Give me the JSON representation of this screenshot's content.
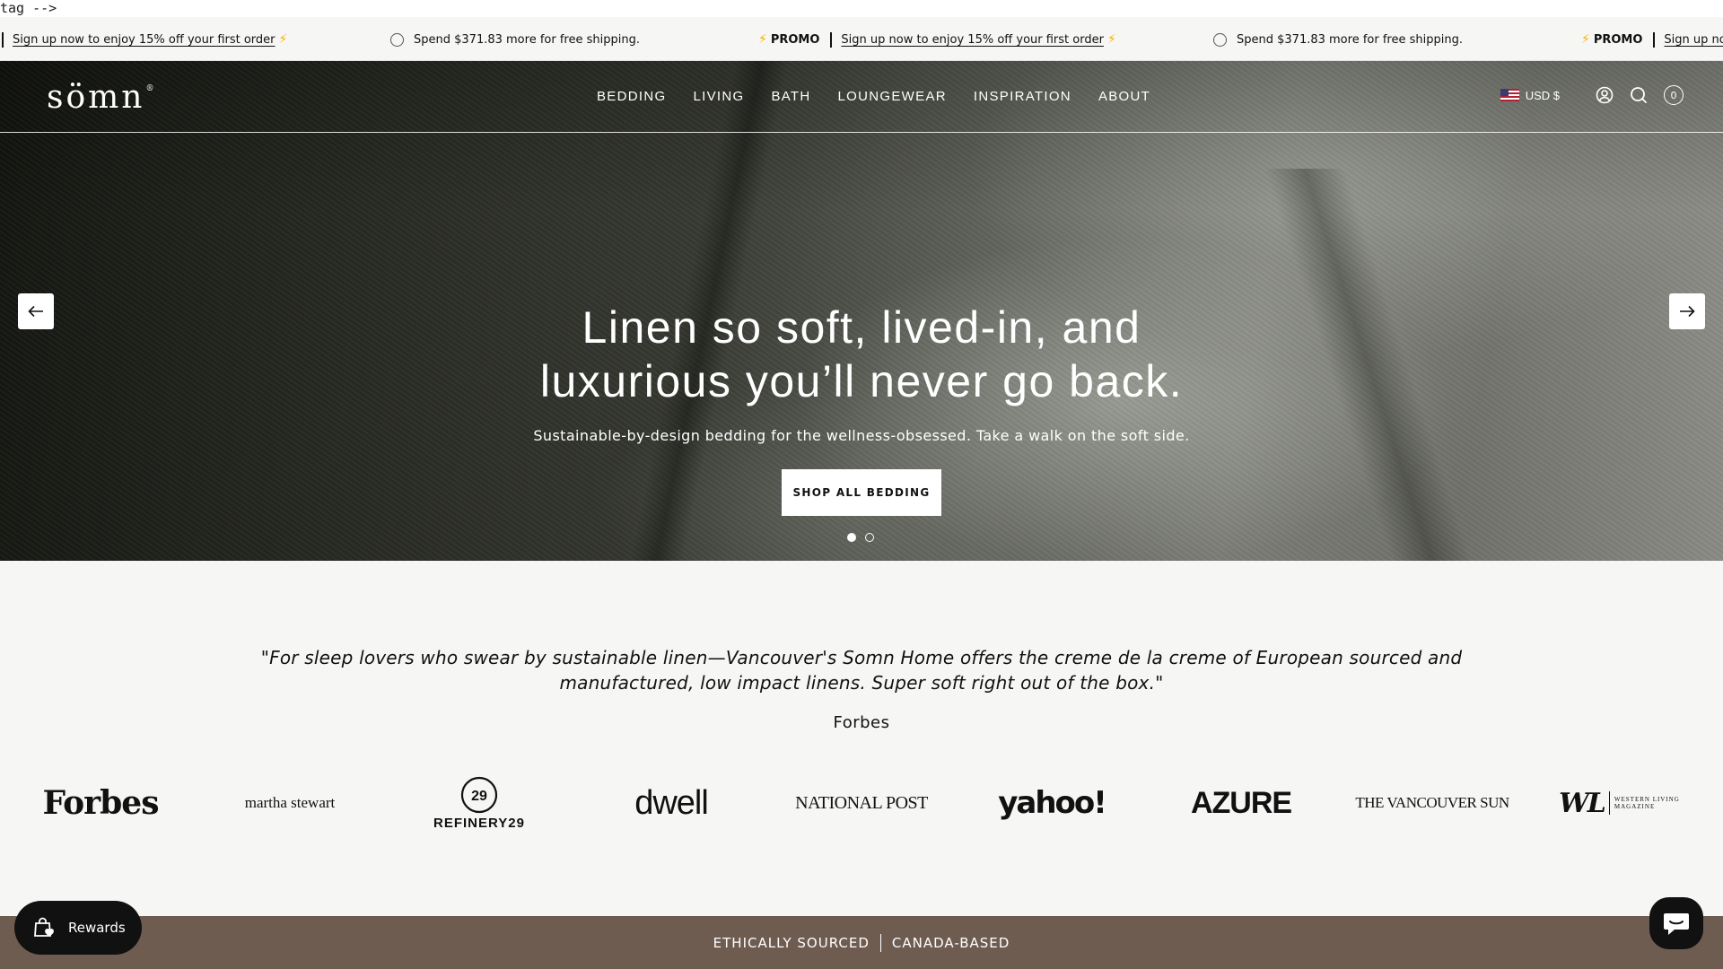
{
  "stray_text": "tag -->",
  "announcement": {
    "signup_text": "Sign up now to enjoy 15% off your first order",
    "shipping_text": "Spend $371.83 more for free shipping.",
    "promo_label": "PROMO",
    "signup_text_cut": "Sign up now"
  },
  "header": {
    "logo": "sömn",
    "logo_mark": "®",
    "nav": [
      "BEDDING",
      "LIVING",
      "BATH",
      "LOUNGEWEAR",
      "INSPIRATION",
      "ABOUT"
    ],
    "currency": "USD $",
    "cart_count": "0"
  },
  "hero": {
    "title_line1": "Linen so soft, lived-in, and",
    "title_line2": "luxurious you’ll never go back.",
    "subtitle": "Sustainable-by-design bedding for the wellness-obsessed. Take a walk on the soft side.",
    "cta": "SHOP ALL BEDDING",
    "slide_count": 2,
    "active_slide": 1
  },
  "press": {
    "quote": "\"For sleep lovers who swear by sustainable linen—Vancouver's Somn Home offers the creme de la creme of European sourced and manufactured, low impact linens. Super soft right out of the box.\"",
    "source": "Forbes",
    "logos": [
      "Forbes",
      "martha stewart",
      "REFINERY29",
      "dwell",
      "NATIONAL POST",
      "yahoo!",
      "AZURE",
      "THE VANCOUVER SUN",
      "WESTERN LIVING MAGAZINE"
    ]
  },
  "bottom_bar": {
    "left": "ETHICALLY SOURCED",
    "right": "CANADA-BASED"
  },
  "widgets": {
    "rewards_label": "Rewards"
  },
  "colors": {
    "bottom_bar_bg": "#6e5c51",
    "page_bg": "#f6f6f5",
    "promo_bolt": "#f4b400"
  }
}
